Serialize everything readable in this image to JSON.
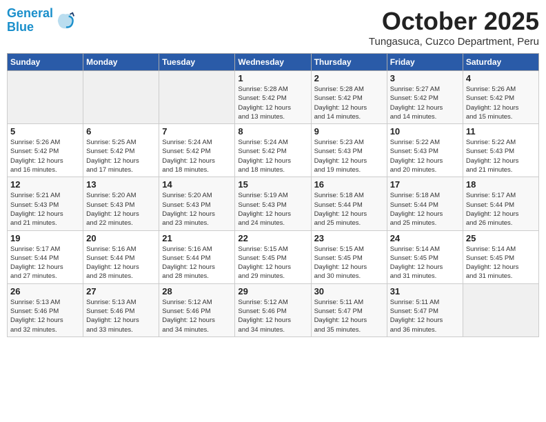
{
  "header": {
    "logo_line1": "General",
    "logo_line2": "Blue",
    "month": "October 2025",
    "location": "Tungasuca, Cuzco Department, Peru"
  },
  "days_of_week": [
    "Sunday",
    "Monday",
    "Tuesday",
    "Wednesday",
    "Thursday",
    "Friday",
    "Saturday"
  ],
  "weeks": [
    [
      {
        "day": "",
        "info": ""
      },
      {
        "day": "",
        "info": ""
      },
      {
        "day": "",
        "info": ""
      },
      {
        "day": "1",
        "info": "Sunrise: 5:28 AM\nSunset: 5:42 PM\nDaylight: 12 hours\nand 13 minutes."
      },
      {
        "day": "2",
        "info": "Sunrise: 5:28 AM\nSunset: 5:42 PM\nDaylight: 12 hours\nand 14 minutes."
      },
      {
        "day": "3",
        "info": "Sunrise: 5:27 AM\nSunset: 5:42 PM\nDaylight: 12 hours\nand 14 minutes."
      },
      {
        "day": "4",
        "info": "Sunrise: 5:26 AM\nSunset: 5:42 PM\nDaylight: 12 hours\nand 15 minutes."
      }
    ],
    [
      {
        "day": "5",
        "info": "Sunrise: 5:26 AM\nSunset: 5:42 PM\nDaylight: 12 hours\nand 16 minutes."
      },
      {
        "day": "6",
        "info": "Sunrise: 5:25 AM\nSunset: 5:42 PM\nDaylight: 12 hours\nand 17 minutes."
      },
      {
        "day": "7",
        "info": "Sunrise: 5:24 AM\nSunset: 5:42 PM\nDaylight: 12 hours\nand 18 minutes."
      },
      {
        "day": "8",
        "info": "Sunrise: 5:24 AM\nSunset: 5:42 PM\nDaylight: 12 hours\nand 18 minutes."
      },
      {
        "day": "9",
        "info": "Sunrise: 5:23 AM\nSunset: 5:43 PM\nDaylight: 12 hours\nand 19 minutes."
      },
      {
        "day": "10",
        "info": "Sunrise: 5:22 AM\nSunset: 5:43 PM\nDaylight: 12 hours\nand 20 minutes."
      },
      {
        "day": "11",
        "info": "Sunrise: 5:22 AM\nSunset: 5:43 PM\nDaylight: 12 hours\nand 21 minutes."
      }
    ],
    [
      {
        "day": "12",
        "info": "Sunrise: 5:21 AM\nSunset: 5:43 PM\nDaylight: 12 hours\nand 21 minutes."
      },
      {
        "day": "13",
        "info": "Sunrise: 5:20 AM\nSunset: 5:43 PM\nDaylight: 12 hours\nand 22 minutes."
      },
      {
        "day": "14",
        "info": "Sunrise: 5:20 AM\nSunset: 5:43 PM\nDaylight: 12 hours\nand 23 minutes."
      },
      {
        "day": "15",
        "info": "Sunrise: 5:19 AM\nSunset: 5:43 PM\nDaylight: 12 hours\nand 24 minutes."
      },
      {
        "day": "16",
        "info": "Sunrise: 5:18 AM\nSunset: 5:44 PM\nDaylight: 12 hours\nand 25 minutes."
      },
      {
        "day": "17",
        "info": "Sunrise: 5:18 AM\nSunset: 5:44 PM\nDaylight: 12 hours\nand 25 minutes."
      },
      {
        "day": "18",
        "info": "Sunrise: 5:17 AM\nSunset: 5:44 PM\nDaylight: 12 hours\nand 26 minutes."
      }
    ],
    [
      {
        "day": "19",
        "info": "Sunrise: 5:17 AM\nSunset: 5:44 PM\nDaylight: 12 hours\nand 27 minutes."
      },
      {
        "day": "20",
        "info": "Sunrise: 5:16 AM\nSunset: 5:44 PM\nDaylight: 12 hours\nand 28 minutes."
      },
      {
        "day": "21",
        "info": "Sunrise: 5:16 AM\nSunset: 5:44 PM\nDaylight: 12 hours\nand 28 minutes."
      },
      {
        "day": "22",
        "info": "Sunrise: 5:15 AM\nSunset: 5:45 PM\nDaylight: 12 hours\nand 29 minutes."
      },
      {
        "day": "23",
        "info": "Sunrise: 5:15 AM\nSunset: 5:45 PM\nDaylight: 12 hours\nand 30 minutes."
      },
      {
        "day": "24",
        "info": "Sunrise: 5:14 AM\nSunset: 5:45 PM\nDaylight: 12 hours\nand 31 minutes."
      },
      {
        "day": "25",
        "info": "Sunrise: 5:14 AM\nSunset: 5:45 PM\nDaylight: 12 hours\nand 31 minutes."
      }
    ],
    [
      {
        "day": "26",
        "info": "Sunrise: 5:13 AM\nSunset: 5:46 PM\nDaylight: 12 hours\nand 32 minutes."
      },
      {
        "day": "27",
        "info": "Sunrise: 5:13 AM\nSunset: 5:46 PM\nDaylight: 12 hours\nand 33 minutes."
      },
      {
        "day": "28",
        "info": "Sunrise: 5:12 AM\nSunset: 5:46 PM\nDaylight: 12 hours\nand 34 minutes."
      },
      {
        "day": "29",
        "info": "Sunrise: 5:12 AM\nSunset: 5:46 PM\nDaylight: 12 hours\nand 34 minutes."
      },
      {
        "day": "30",
        "info": "Sunrise: 5:11 AM\nSunset: 5:47 PM\nDaylight: 12 hours\nand 35 minutes."
      },
      {
        "day": "31",
        "info": "Sunrise: 5:11 AM\nSunset: 5:47 PM\nDaylight: 12 hours\nand 36 minutes."
      },
      {
        "day": "",
        "info": ""
      }
    ]
  ]
}
